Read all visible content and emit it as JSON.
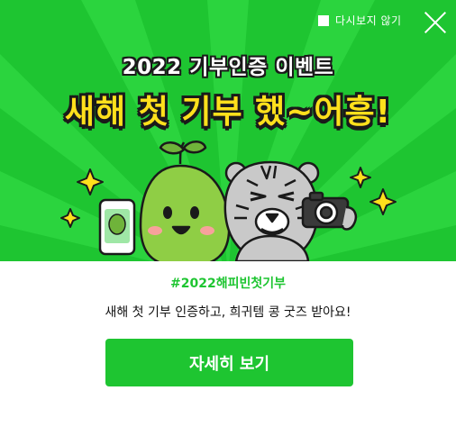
{
  "popup": {
    "dismiss_label": "다시보지 않기",
    "close_icon": "close-icon"
  },
  "banner": {
    "event_title": "2022 기부인증 이벤트",
    "headline": "새해 첫 기부 했~어흥!",
    "illustration": [
      "sprout-character",
      "phone-icon",
      "tiger-character",
      "camera-icon",
      "sparkle-icon"
    ]
  },
  "content": {
    "hashtag": "#2022해피빈첫기부",
    "description": "새해 첫 기부 인증하고, 희귀템 콩 굿즈 받아요!",
    "cta_label": "자세히 보기"
  },
  "colors": {
    "brand_green": "#1ec531",
    "headline_yellow": "#ffe01c",
    "outline": "#1a1a1a"
  }
}
